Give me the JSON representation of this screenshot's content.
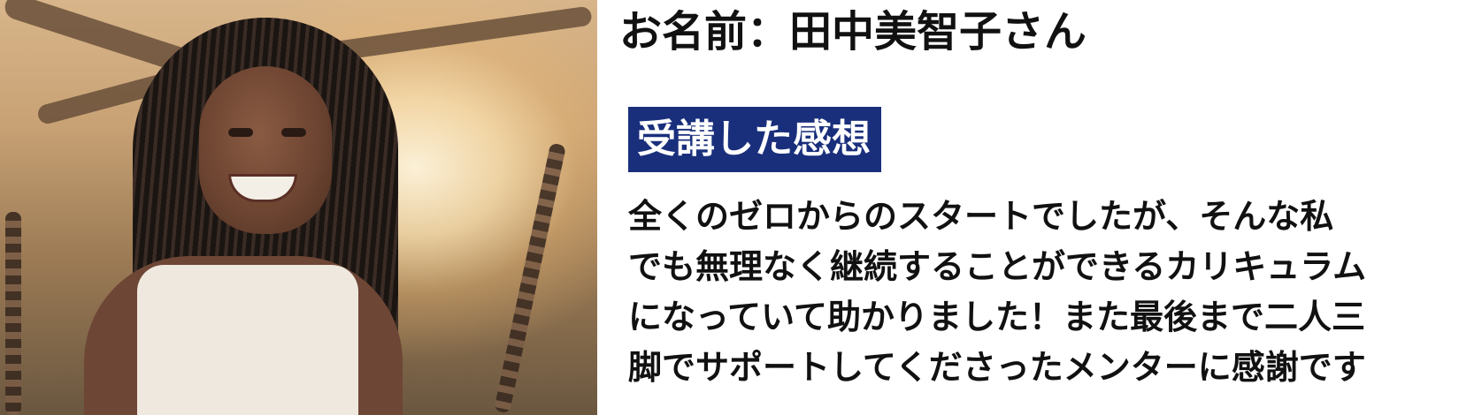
{
  "profile": {
    "name_line": "お名前：田中美智子さん",
    "photo_alt": "Smiling woman with long braided hair sitting on a swing"
  },
  "section": {
    "label": "受講した感想"
  },
  "testimonial": {
    "lines": [
      "全くのゼロからのスタートでしたが、そんな私",
      "でも無理なく継続することができるカリキュラム",
      "になっていて助かりました！また最後まで二人三",
      "脚でサポートしてくださったメンターに感謝です"
    ]
  },
  "colors": {
    "label_background": "#1a2f7c",
    "label_text": "#ffffff",
    "body_text": "#111111",
    "page_background": "#ffffff"
  }
}
